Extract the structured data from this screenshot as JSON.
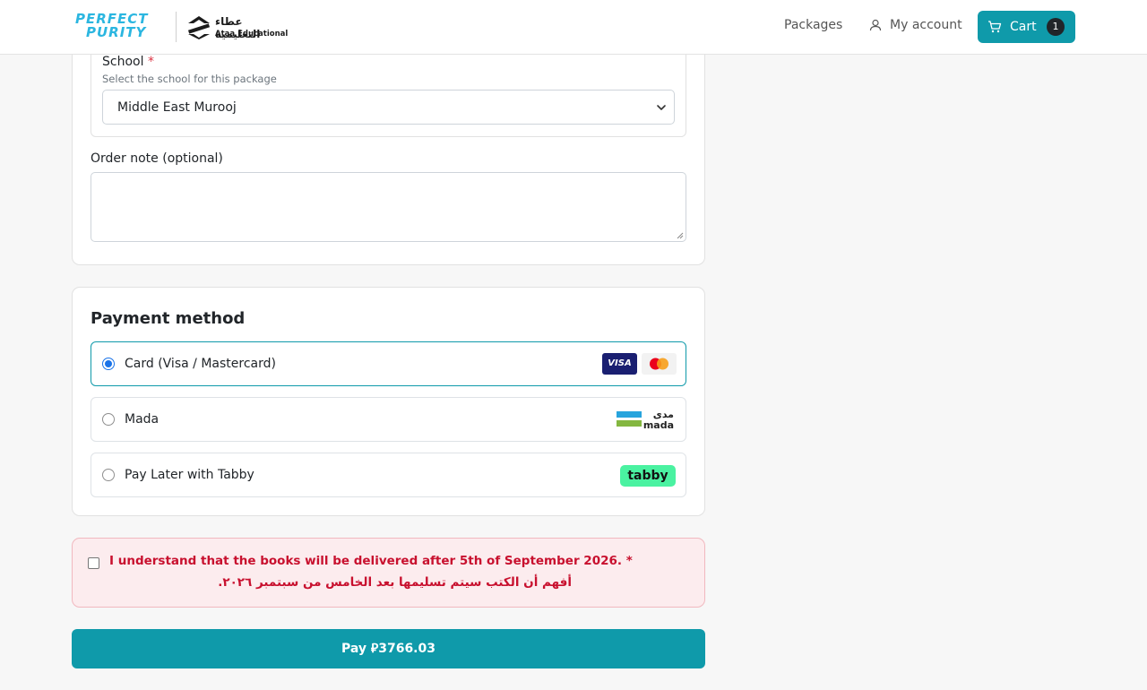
{
  "colors": {
    "accent": "#0f9aaa",
    "danger": "#c8102e",
    "brand_light_blue": "#2bb6e0"
  },
  "header": {
    "brand_line1": "PERFECT",
    "brand_line2": "PURITY",
    "partner_ar": "عطاء التعليمية",
    "partner_en": "Ataa Educational",
    "nav_packages": "Packages",
    "nav_account": "My account",
    "cart_label": "Cart",
    "cart_count": "1"
  },
  "order": {
    "school_label": "School",
    "required_mark": "*",
    "school_help": "Select the school for this package",
    "school_value": "Middle East Murooj",
    "note_label": "Order note (optional)",
    "note_value": ""
  },
  "payment": {
    "title": "Payment method",
    "options": [
      {
        "label": "Card (Visa / Mastercard)",
        "selected": true,
        "icons": [
          "visa-icon",
          "mastercard-icon"
        ]
      },
      {
        "label": "Mada",
        "selected": false,
        "icons": [
          "mada-icon"
        ]
      },
      {
        "label": "Pay Later with Tabby",
        "selected": false,
        "icons": [
          "tabby-icon"
        ]
      }
    ],
    "visa_text": "VISA",
    "mada_ar": "مدى",
    "mada_en": "mada",
    "tabby_text": "tabby"
  },
  "agreement": {
    "checked": false,
    "text_en": "I understand that the books will be delivered after 5th of September 2026. *",
    "text_ar": "أفهم أن الكتب سيتم تسليمها بعد الخامس من سبتمبر ٢٠٢٦."
  },
  "pay_button": {
    "label": "Pay ⃁3766.03"
  }
}
